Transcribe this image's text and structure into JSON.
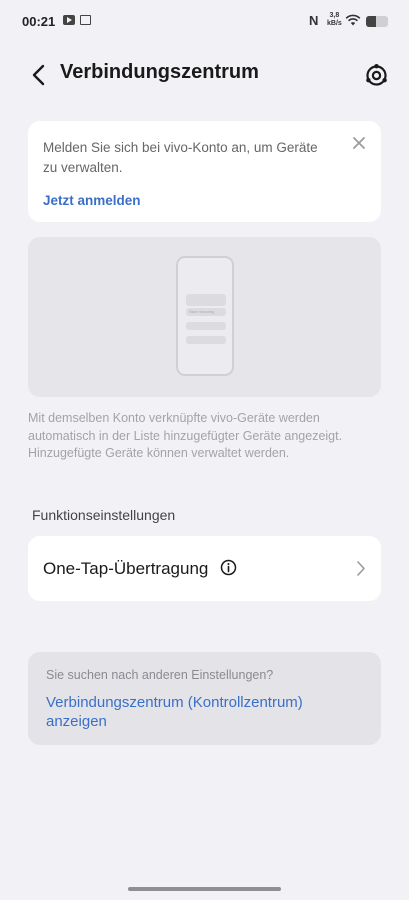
{
  "status_bar": {
    "time": "00:21",
    "nfc": "N",
    "speed_value": "3,8",
    "speed_unit": "kB/s",
    "battery_level": 0.45,
    "icons": [
      "youtube-icon",
      "message-icon",
      "nfc-icon",
      "wifi-icon",
      "battery-icon"
    ]
  },
  "header": {
    "title": "Verbindungszentrum",
    "icons": [
      "back-arrow-icon",
      "settings-gear-icon"
    ]
  },
  "login_card": {
    "message": "Melden Sie sich bei vivo-Konto an, um Geräte zu verwalten.",
    "link": "Jetzt anmelden",
    "close_icon": "close-icon"
  },
  "illustration": {
    "phone_label": "Start mirroring"
  },
  "description": "Mit demselben Konto verknüpfte vivo-Geräte werden automatisch in der Liste hinzugefügter Geräte angezeigt. Hinzugefügte Geräte können verwaltet werden.",
  "section": {
    "title": "Funktionseinstellungen"
  },
  "one_tap": {
    "label": "One-Tap-Übertragung",
    "icons": [
      "info-icon",
      "chevron-right-icon"
    ]
  },
  "other_settings": {
    "question": "Sie suchen nach anderen Einstellungen?",
    "link": "Verbindungszentrum (Kontrollzentrum) anzeigen"
  },
  "colors": {
    "background": "#f2f2f6",
    "card": "#ffffff",
    "link": "#3a6fc8",
    "muted_text": "#a3a3a8"
  }
}
